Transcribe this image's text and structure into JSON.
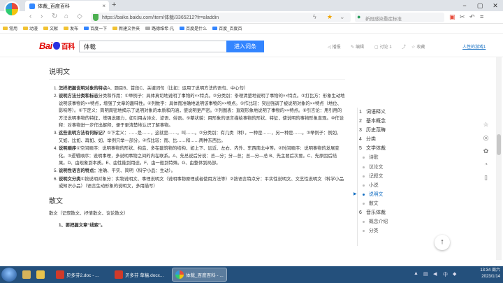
{
  "browser": {
    "tab_title": "体裁_百度百科",
    "tab_close": "×",
    "new_tab": "+",
    "window_controls": [
      "−",
      "▢",
      "✕"
    ],
    "url": "https://baike.baidu.com/item/体裁/3365212?fr=aladdin",
    "side_search_placeholder": "新冠感染重症标准"
  },
  "bookmarks": [
    "常用",
    "动漫",
    "文献",
    "发布",
    "百度一下",
    "新建文件夹",
    "路德维希·凡",
    "百度是什么",
    "百度_百度百"
  ],
  "baike_header": {
    "logo_bai": "Bai",
    "logo_du": "du",
    "logo_baike": "百科",
    "search_value": "体裁",
    "enter_button": "进入词条",
    "actions": [
      "播报",
      "编辑",
      "讨论 1",
      "收藏"
    ],
    "user": "人性的游戏1"
  },
  "content": {
    "section_title": "说明文",
    "items": [
      {
        "lead": "怎样把握说明对象的特点",
        "text": "A、题目B、首段C、关键词句（比如：运用了说明方法的语句、中心句）"
      },
      {
        "lead": "说明方法分类和标志",
        "text": "分类和作用：①举例子：具体真切地说明了事物的××特点。②分类别：条理清楚地说明了事物的××特点。③打比方：形象生动地说明该事物的××特点，增强了文章的趣味性。④列数字：具体而准确地说明该事物的××特点。⑤作比较：突出强调了被说明对象的××特点（地位、影响等）。⑥下定义：简明周密地揭示了说明对象的本质和内涵，使说明更严密。⑦列图表：直观形象地说明了事物的××特点。⑧引言论：用引用的方法说明事物的特征，增强说服力，如引用古诗文、谚语、俗语。⑨摹状貌：用形象的语言描绘事物的形状、特征，使说明的事物形象直观。⑩作诠释：对事物进一步作出解释，便于更清楚地认识了解事物。"
      },
      {
        "lead": "这些说明方法有何标记？",
        "text": "①下定义：……是……，这就是……，叫……。②分类别：有几类（种），一种是……，另一种是……。③举例子：例如、又如、比如、再如、如、举例只举一部分。④作比较：而、比……和……两种东西比。"
      },
      {
        "lead": "说明顺序",
        "text": "①空间顺序：说明事物的形状、构造，多在建筑物的结构，如上下、远近、左右、内外、东西南北中等。②时间顺序：说明事物的发展变化。③逻辑顺序：说明事理，多说明事物之间的内在联系。A、先总说后分说：总—分；分—总；总—分—总 B、先主要后次要。C、先原因后结果。D、由现象到本质。E、由性能到用途。F、由一般到特殊。G、由整体到局部。"
      },
      {
        "lead": "说明性语言的特点：",
        "text": "准确、平实、简明（科学小品：生动）。"
      },
      {
        "lead": "说明文分类",
        "text": "①按说明对象分：实物说明文、事理说明文（说明事物原理或者使用方法等）②按语言特点分：平实性说明文、文艺性说明文（科学小品或知识小品）（语言生动形象的说明文，多用描写）"
      }
    ],
    "section2_title": "散文",
    "section2_sub": "散文（记叙散文、抒情散文、议论散文）",
    "tail_item": "1、要把握文章“线索”。"
  },
  "catalog": {
    "items": [
      {
        "num": "1",
        "label": "词语释义"
      },
      {
        "num": "2",
        "label": "基本概念"
      },
      {
        "num": "3",
        "label": "历史范畴"
      },
      {
        "num": "4",
        "label": "分类"
      },
      {
        "num": "5",
        "label": "文学体裁"
      }
    ],
    "subs5": [
      "诗歌",
      "议论文",
      "记叙文",
      "小说",
      "说明文",
      "散文"
    ],
    "active_marker": "▶",
    "item6": {
      "num": "6",
      "label": "音乐体裁"
    },
    "subs6": [
      "概念介绍",
      "分类"
    ]
  },
  "side_tools": [
    "☆",
    "◎",
    "✿",
    "◔",
    "▯"
  ],
  "back_to_top": "↑",
  "taskbar": {
    "buttons": [
      "贝多芬2.doc - ...",
      "贝多芬 草稿.docx...",
      "体裁_百度百科 - ..."
    ],
    "time": "13:34 周六",
    "date": "2023/1/14"
  }
}
